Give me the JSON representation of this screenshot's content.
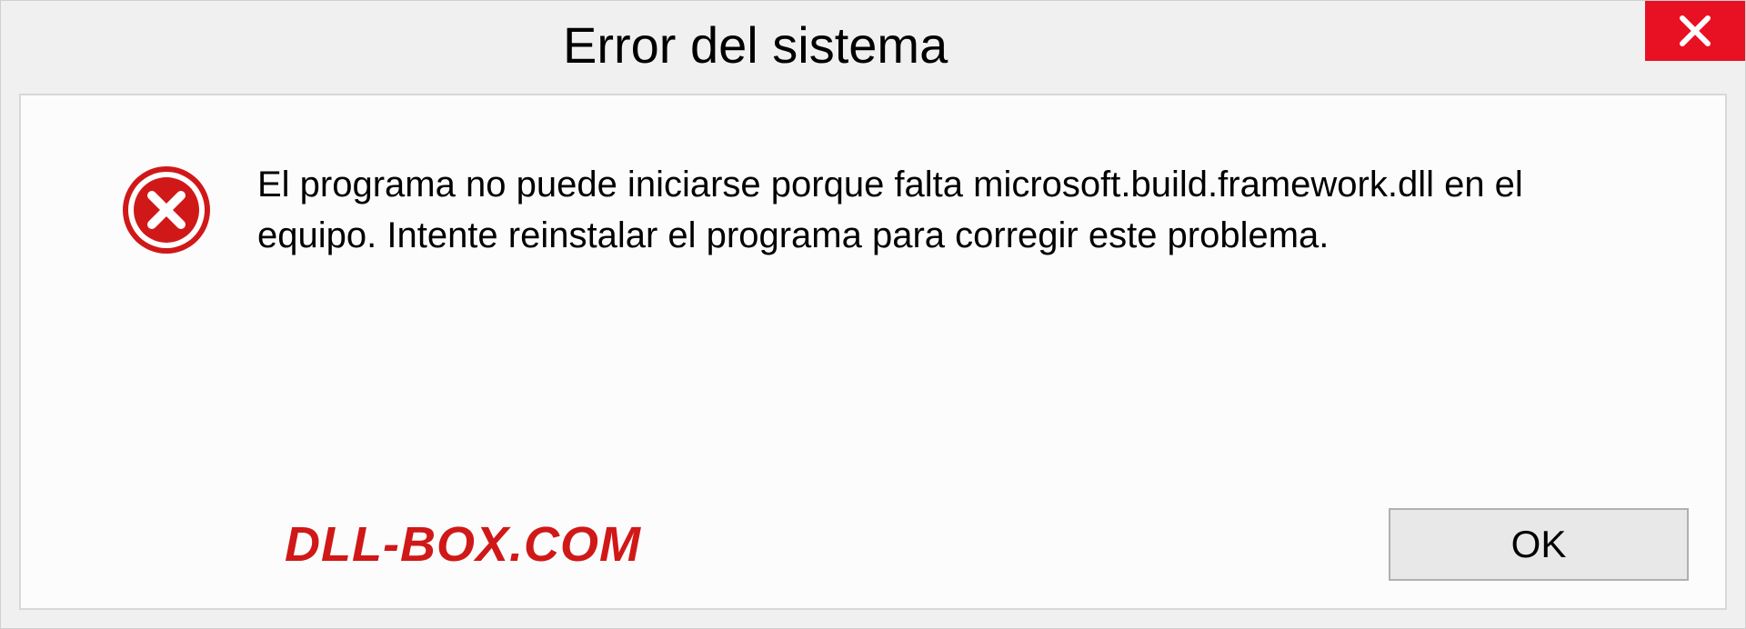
{
  "dialog": {
    "title": "Error del sistema",
    "message": "El programa no puede iniciarse porque falta microsoft.build.framework.dll en el equipo. Intente reinstalar el programa para corregir este problema.",
    "ok_label": "OK",
    "watermark": "DLL-BOX.COM"
  },
  "colors": {
    "close_bg": "#e81123",
    "watermark": "#d01818"
  }
}
